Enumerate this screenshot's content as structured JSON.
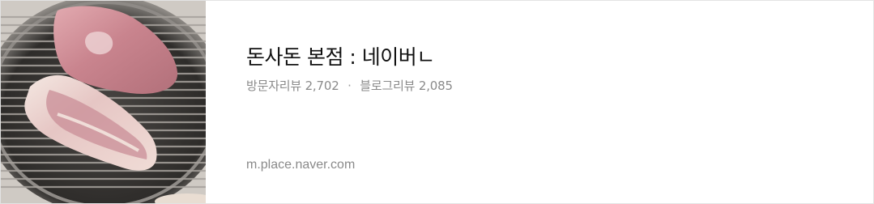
{
  "card": {
    "title": "돈사돈 본점 : 네이버ㄴ",
    "visit_review_label": "방문자리뷰",
    "visit_review_count": "2,702",
    "separator": "·",
    "blog_review_label": "블로그리뷰",
    "blog_review_count": "2,085",
    "url": "m.place.naver.com"
  },
  "thumbnail": {
    "subject": "pork-on-grill-photo"
  }
}
